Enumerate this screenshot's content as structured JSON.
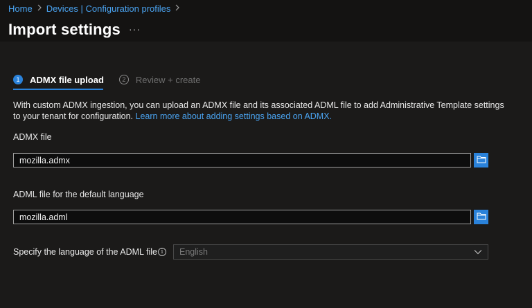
{
  "breadcrumb": {
    "items": [
      "Home",
      "Devices | Configuration profiles"
    ]
  },
  "header": {
    "title": "Import settings",
    "more": "···"
  },
  "wizard": {
    "tabs": [
      {
        "number": "1",
        "label": "ADMX file upload",
        "active": true
      },
      {
        "number": "2",
        "label": "Review + create",
        "active": false
      }
    ]
  },
  "description": {
    "text": "With custom ADMX ingestion, you can upload an ADMX file and its associated ADML file to add Administrative Template settings to your tenant for configuration.",
    "link": "Learn more about adding settings based on ADMX."
  },
  "form": {
    "admx_label": "ADMX file",
    "admx_value": "mozilla.admx",
    "adml_label": "ADML file for the default language",
    "adml_value": "mozilla.adml",
    "language_label": "Specify the language of the ADML file",
    "language_value": "English"
  },
  "colors": {
    "accent": "#2a82da",
    "link": "#4aa3f0",
    "background": "#1b1a19"
  },
  "icons": {
    "browse": "folder-icon",
    "info": "info-icon",
    "dropdown": "chevron-down-icon",
    "breadcrumb_separator": "chevron-right-icon"
  }
}
